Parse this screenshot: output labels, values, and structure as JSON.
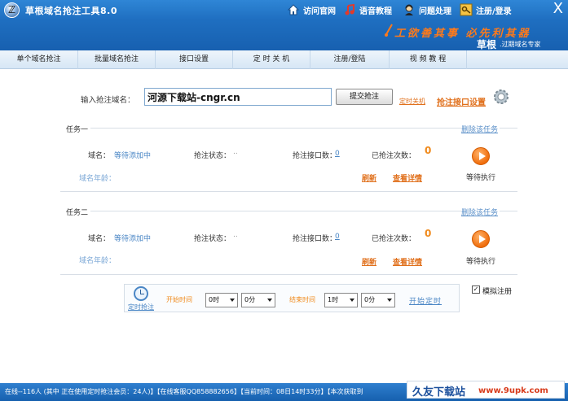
{
  "window": {
    "title": "草根域名抢注工具8.0"
  },
  "topbar": {
    "links": [
      {
        "label": "访问官网",
        "icon": "house-icon"
      },
      {
        "label": "语音教程",
        "icon": "music-note-icon"
      },
      {
        "label": "问题处理",
        "icon": "support-person-icon"
      },
      {
        "label": "注册/登录",
        "icon": "key-icon"
      }
    ],
    "close": "X",
    "slogan": "工欲善其事 必先利其器",
    "brand": "草根",
    "brand_sub": ".过期域名专家"
  },
  "nav": {
    "tabs": [
      "单个域名抢注",
      "批量域名抢注",
      "接口设置",
      "定 时 关 机",
      "注册/登陆",
      "视 频 教 程"
    ]
  },
  "form": {
    "domain_label": "输入抢注域名：",
    "domain_value": "河源下载站-cngr.cn",
    "submit_label": "提交抢注",
    "timer_link": "定时关机",
    "api_settings_link": "抢注接口设置"
  },
  "tasks": [
    {
      "title": "任务一",
      "delete_label": "删除该任务",
      "domain_label": "域名：",
      "domain_value": "等待添加中",
      "status_label": "抢注状态：",
      "status_value": "..",
      "api_count_label": "抢注接口数：",
      "api_count_value": "0",
      "times_label": "已抢注次数：",
      "times_value": "0",
      "age_label": "域名年龄：",
      "refresh_label": "刷新",
      "detail_label": "查看详情",
      "wait_label": "等待执行"
    },
    {
      "title": "任务二",
      "delete_label": "删除该任务",
      "domain_label": "域名：",
      "domain_value": "等待添加中",
      "status_label": "抢注状态：",
      "status_value": "..",
      "api_count_label": "抢注接口数：",
      "api_count_value": "0",
      "times_label": "已抢注次数：",
      "times_value": "0",
      "age_label": "域名年龄：",
      "refresh_label": "刷新",
      "detail_label": "查看详情",
      "wait_label": "等待执行"
    }
  ],
  "schedule": {
    "label": "定时抢注",
    "start_time_label": "开始时间",
    "start_hour": "0时",
    "start_minute": "0分",
    "end_time_label": "结束时间",
    "end_hour": "1时",
    "end_minute": "0分",
    "start_link": "开始定时",
    "simulate_label": "模拟注册",
    "simulate_checked": "✓"
  },
  "status": {
    "text": "在线--116人 (其中 正在使用定时抢注会员：24人)】【在线客服QQ858882656】【当前时间：08日14时33分】【本次获取到"
  },
  "watermark": {
    "big": "久友下载站",
    "small": "www.9upk.com"
  }
}
